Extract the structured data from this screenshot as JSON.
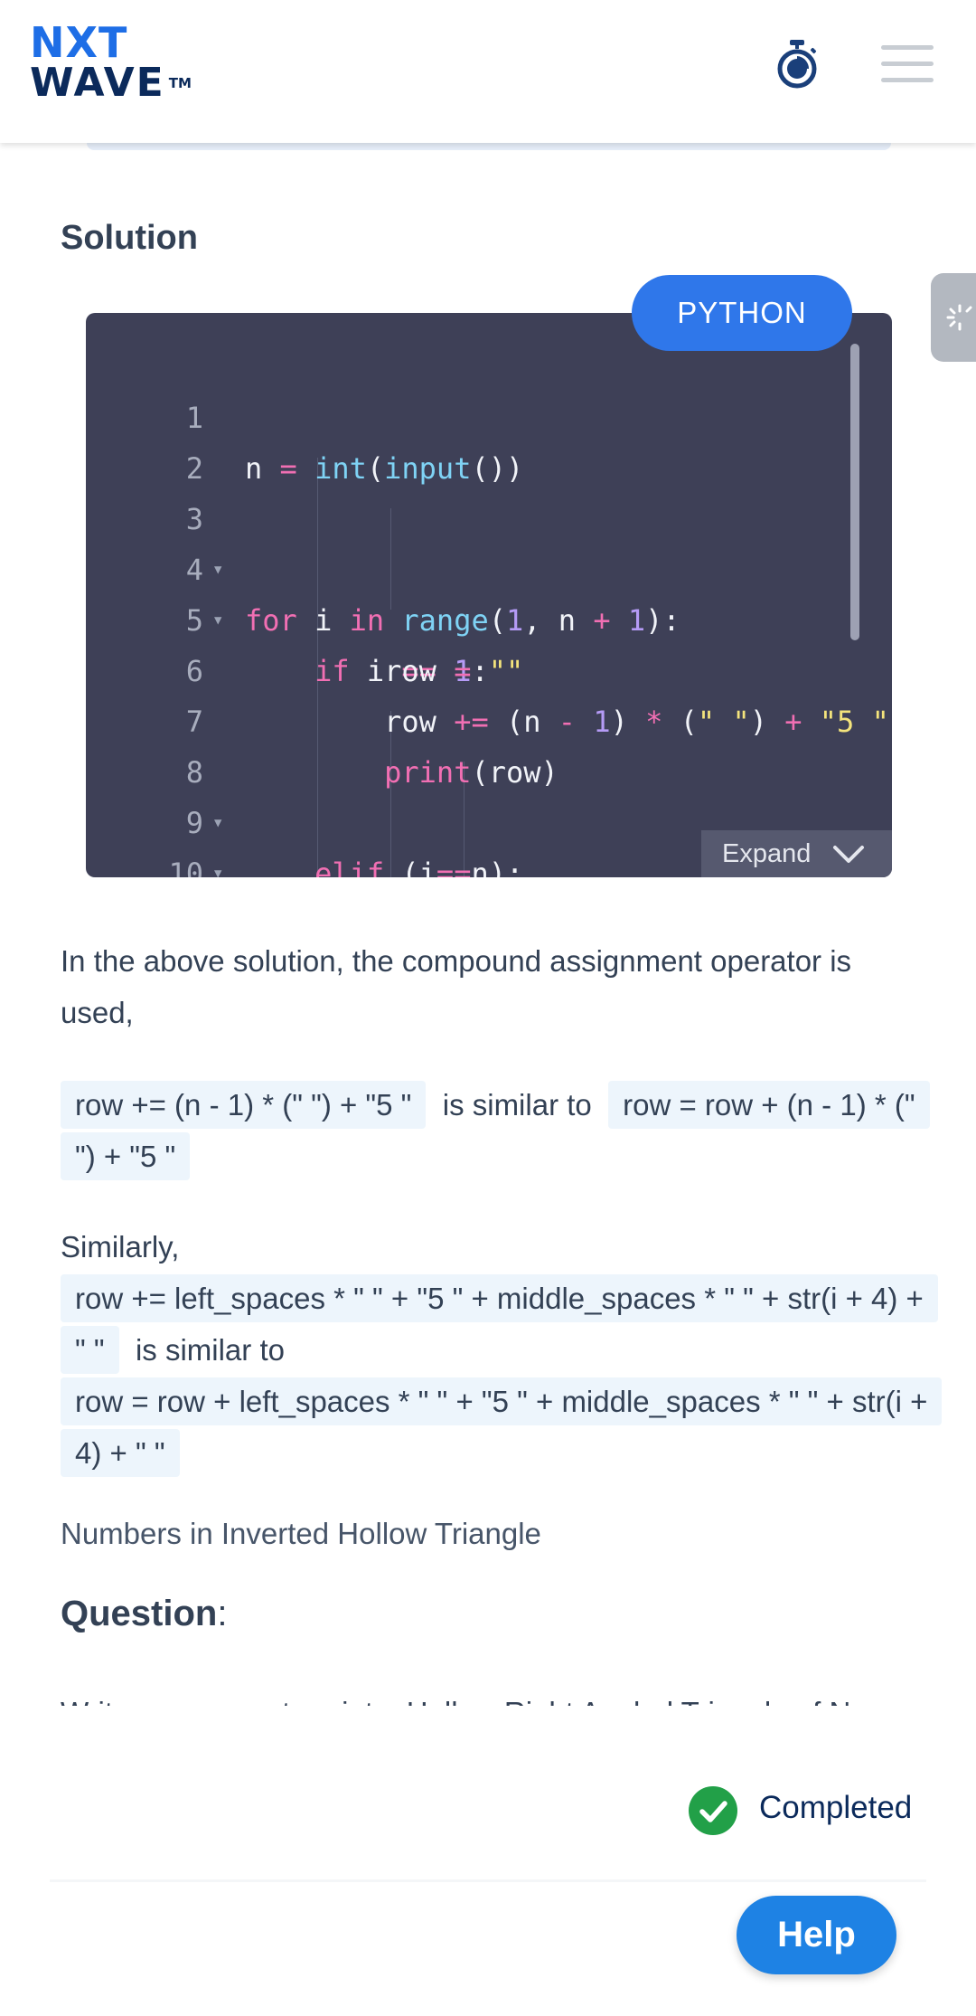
{
  "header": {
    "logo_line1": "NXT",
    "logo_line2": "WAVE",
    "logo_tm": "TM"
  },
  "solution": {
    "title": "Solution",
    "language": "PYTHON",
    "expand_label": "Expand",
    "code_lines": [
      {
        "n": "1"
      },
      {
        "n": "2"
      },
      {
        "n": "3"
      },
      {
        "n": "4"
      },
      {
        "n": "5"
      },
      {
        "n": "6"
      },
      {
        "n": "7"
      },
      {
        "n": "8"
      },
      {
        "n": "9"
      },
      {
        "n": "10"
      }
    ]
  },
  "explanation": {
    "p1": "In the above solution, the compound assignment operator is used,",
    "chip1": "row += (n - 1) * (\" \") + \"5 \"",
    "similar": "is similar to",
    "chip2": "row = row + (n - 1) * (\" \") + \"5 \"",
    "similarly": "Similarly,",
    "chip3": "row += left_spaces * \" \" + \"5 \" + middle_spaces * \" \" + str(i + 4) + \" \"",
    "chip4": "row = row + left_spaces * \" \" + \"5 \" + middle_spaces * \" \" + str(i + 4) + \" \""
  },
  "next_topic": "Numbers in Inverted Hollow Triangle",
  "question": {
    "title": "Question",
    "cut_text": "Write a program to print a Hollow Right Angled Triangle of N"
  },
  "status": {
    "completed_label": "Completed"
  },
  "help": {
    "label": "Help"
  },
  "colors": {
    "brand_blue": "#1e6ee6",
    "badge_blue": "#2f77ea",
    "editor_bg": "#3e4057",
    "complete_green": "#22a048",
    "help_blue": "#1e82e4"
  },
  "icons": [
    "timer-icon",
    "hamburger-menu-icon",
    "chevron-down-icon",
    "check-circle-icon"
  ]
}
